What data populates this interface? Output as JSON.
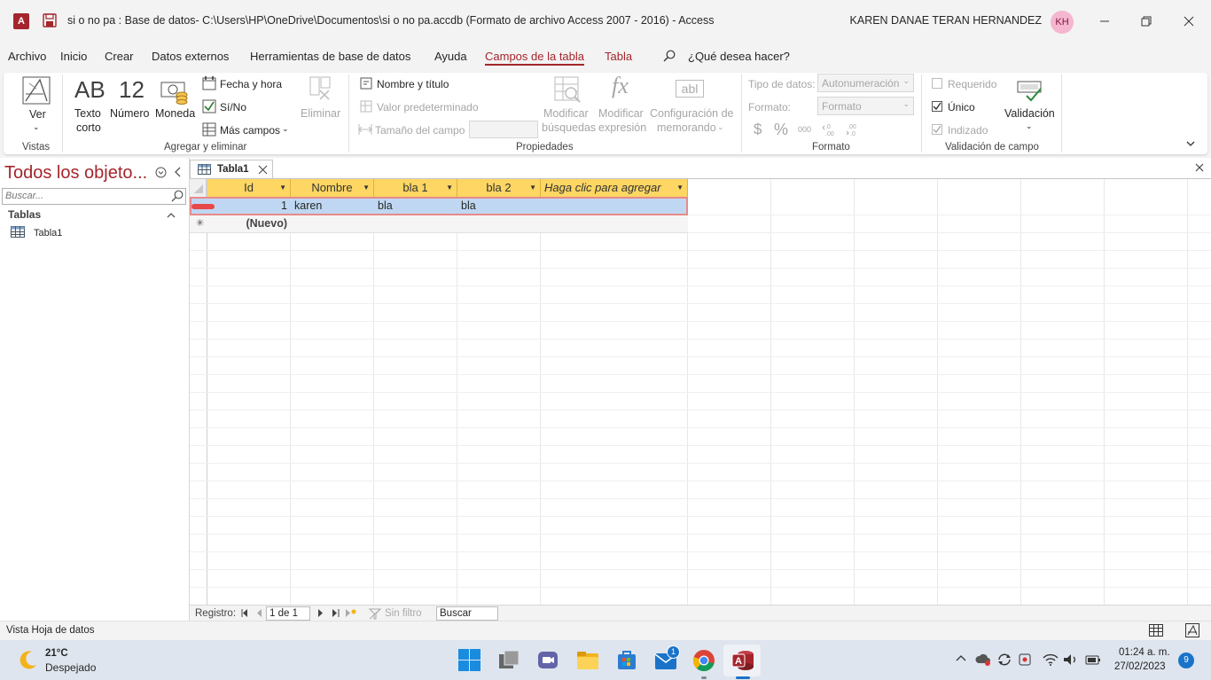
{
  "window": {
    "title": "si o no pa : Base de datos- C:\\Users\\HP\\OneDrive\\Documentos\\si o no pa.accdb (Formato de archivo Access 2007 - 2016)  -  Access",
    "app_icon_letter": "A",
    "user_name": "KAREN DANAE TERAN HERNANDEZ",
    "user_initials": "KH"
  },
  "menu": {
    "tabs": [
      "Archivo",
      "Inicio",
      "Crear",
      "Datos externos",
      "Herramientas de base de datos",
      "Ayuda",
      "Campos de la tabla",
      "Tabla"
    ],
    "search_label": "¿Qué desea hacer?"
  },
  "ribbon": {
    "vistas": {
      "ver": "Ver",
      "group": "Vistas"
    },
    "agregar": {
      "texto_corto_line1": "Texto",
      "texto_corto_line2": "corto",
      "texto_glyph": "AB",
      "numero_glyph": "12",
      "numero": "Número",
      "moneda": "Moneda",
      "fecha_hora": "Fecha y hora",
      "si_no": "Sí/No",
      "mas_campos": "Más campos",
      "eliminar": "Eliminar",
      "group": "Agregar y eliminar"
    },
    "propiedades": {
      "nombre_titulo": "Nombre y título",
      "valor_predeterminado": "Valor predeterminado",
      "tamano_campo": "Tamaño del campo",
      "modificar_busquedas_line1": "Modificar",
      "modificar_busquedas_line2": "búsquedas",
      "modificar_expresion_line1": "Modificar",
      "modificar_expresion_line2": "expresión",
      "fx_glyph": "fx",
      "abl_glyph": "abl",
      "config_memorando_line1": "Configuración de",
      "config_memorando_line2": "memorando",
      "group": "Propiedades"
    },
    "formato": {
      "tipo_datos_label": "Tipo de datos:",
      "tipo_datos_value": "Autonumeración",
      "formato_label": "Formato:",
      "formato_value": "Formato",
      "currency_glyph": "$",
      "percent_glyph": "%",
      "thousands_glyph": "000",
      "group": "Formato"
    },
    "validacion": {
      "requerido": "Requerido",
      "unico": "Único",
      "indizado": "Indizado",
      "validacion": "Validación",
      "group": "Validación de campo"
    }
  },
  "nav_pane": {
    "title": "Todos los objeto...",
    "search_placeholder": "Buscar...",
    "section": "Tablas",
    "items": [
      "Tabla1"
    ]
  },
  "document": {
    "tab_label": "Tabla1",
    "columns": [
      "Id",
      "Nombre",
      "bla 1",
      "bla 2",
      "Haga clic para agregar"
    ],
    "rows": [
      {
        "id": "1",
        "nombre": "karen",
        "bla1": "bla",
        "bla2": "bla"
      }
    ],
    "new_row_label": "(Nuevo)",
    "new_row_marker": "✳"
  },
  "record_nav": {
    "label": "Registro:",
    "position": "1 de 1",
    "filter": "Sin filtro",
    "search": "Buscar"
  },
  "status": {
    "view": "Vista Hoja de datos"
  },
  "taskbar": {
    "weather_temp": "21°C",
    "weather_desc": "Despejado",
    "mail_badge": "1",
    "time": "01:24 a. m.",
    "date": "27/02/2023",
    "notif_count": "9"
  },
  "colors": {
    "accent": "#a4262c",
    "header_fill": "#fdd663",
    "selected_row": "#bfd7f2"
  }
}
